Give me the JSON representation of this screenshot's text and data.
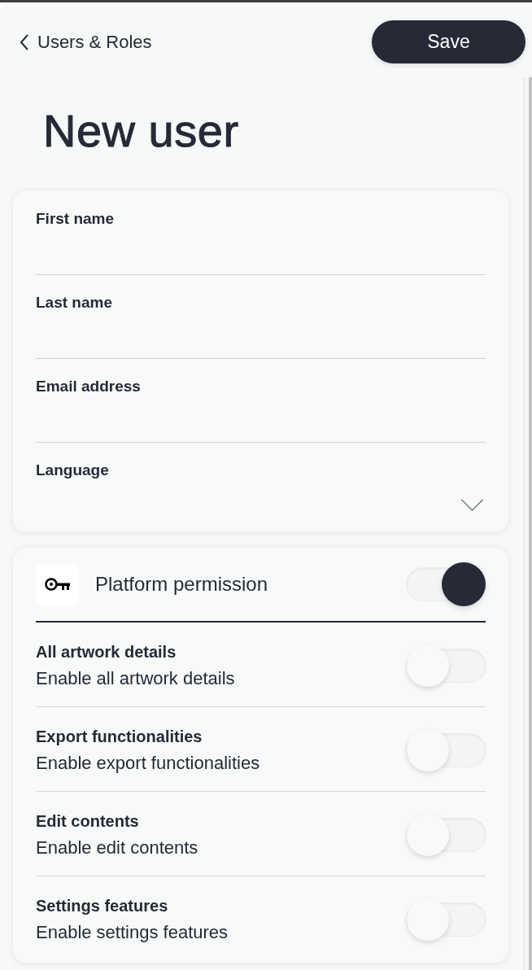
{
  "header": {
    "back_link": {
      "label": "Users & Roles"
    },
    "save_button": {
      "label": "Save"
    }
  },
  "title": "New user",
  "form": {
    "fields": [
      {
        "label": "First name",
        "kind": "text"
      },
      {
        "label": "Last name",
        "kind": "text"
      },
      {
        "label": "Email address",
        "kind": "text"
      },
      {
        "label": "Language",
        "kind": "select"
      }
    ]
  },
  "permissions": {
    "header": {
      "label": "Platform permission",
      "on": true
    },
    "items": [
      {
        "title": "All artwork details",
        "description": "Enable all artwork details",
        "on": false
      },
      {
        "title": "Export functionalities",
        "description": "Enable export functionalities",
        "on": false
      },
      {
        "title": "Edit contents",
        "description": "Enable edit contents",
        "on": false
      },
      {
        "title": "Settings features",
        "description": "Enable settings features",
        "on": false
      }
    ]
  }
}
